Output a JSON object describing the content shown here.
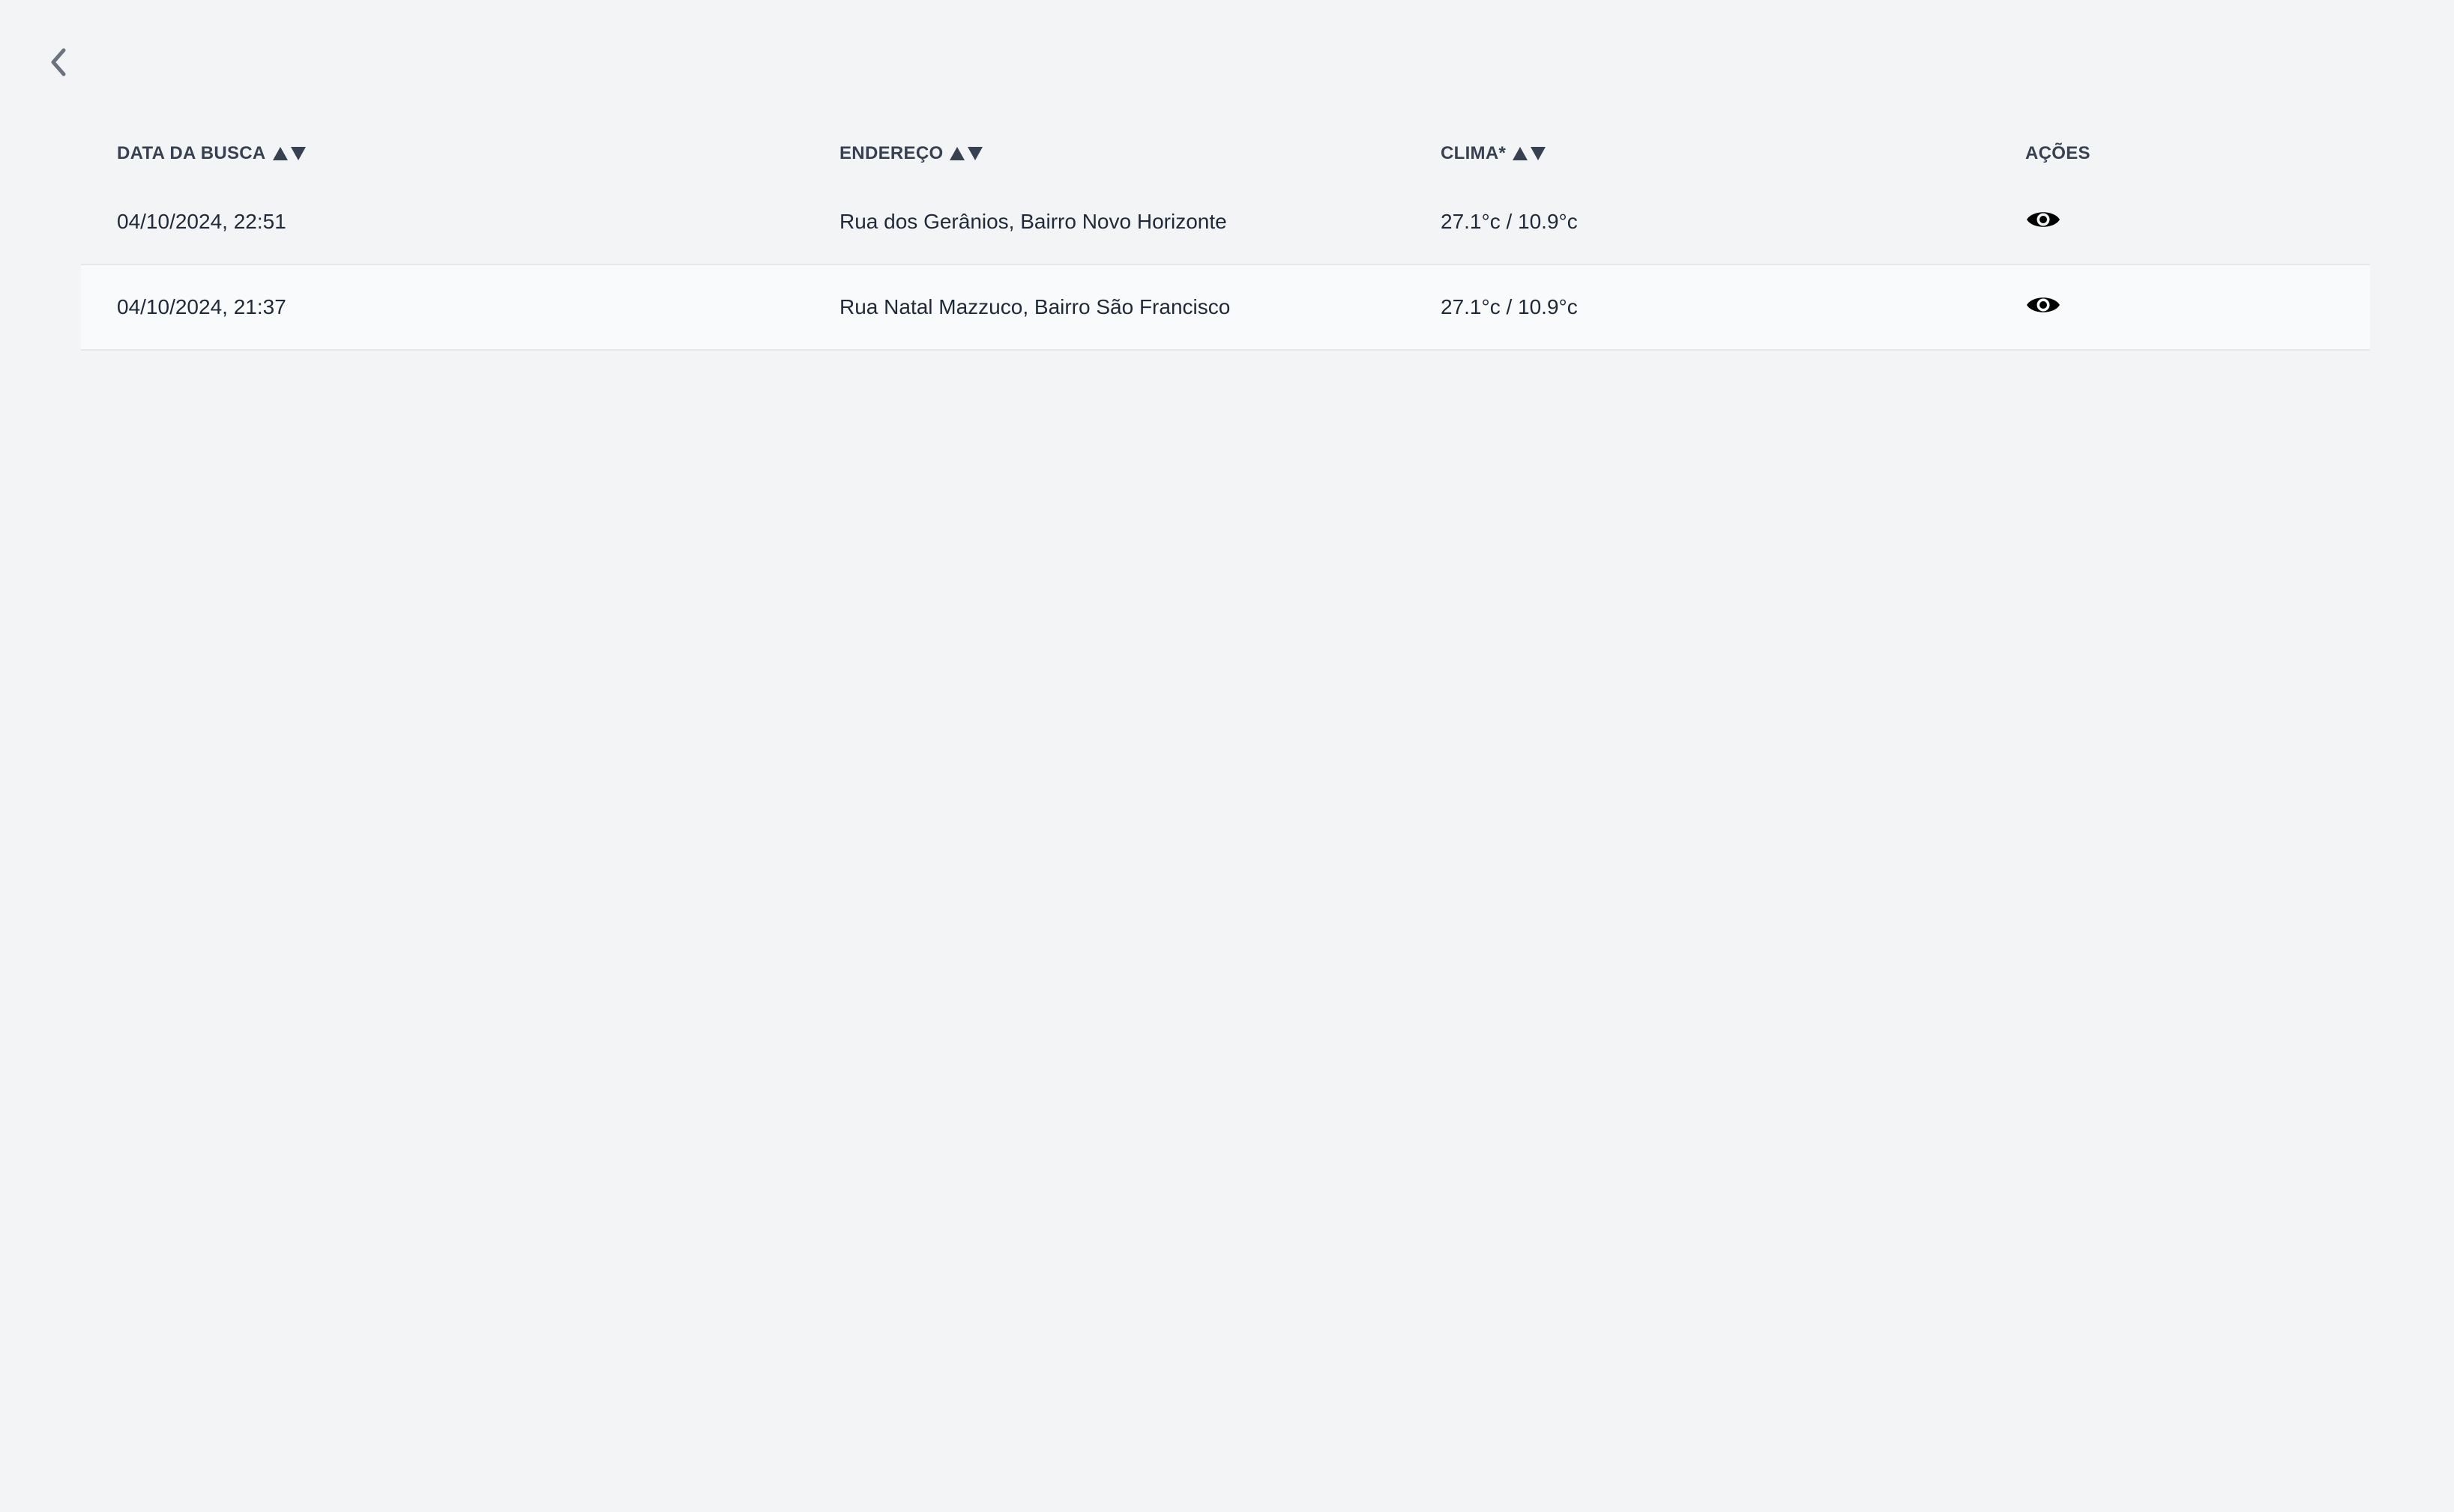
{
  "nav": {
    "back_icon": "chevron-left-icon"
  },
  "table": {
    "columns": [
      {
        "label": "DATA DA BUSCA",
        "sortable": true
      },
      {
        "label": "ENDEREÇO",
        "sortable": true
      },
      {
        "label": "CLIMA*",
        "sortable": true
      },
      {
        "label": "AÇÕES",
        "sortable": false
      }
    ],
    "rows": [
      {
        "date": "04/10/2024, 22:51",
        "address": "Rua dos Gerânios, Bairro Novo Horizonte",
        "climate": "27.1°c / 10.9°c",
        "action_icon": "eye-icon"
      },
      {
        "date": "04/10/2024, 21:37",
        "address": "Rua Natal Mazzuco, Bairro São Francisco",
        "climate": "27.1°c / 10.9°c",
        "action_icon": "eye-icon"
      }
    ]
  },
  "colors": {
    "background": "#f3f4f6",
    "row_alt": "#f9fafb",
    "header_text": "#374151",
    "body_text": "#1f2937",
    "back_icon": "#6b7280",
    "eye_icon": "#000000"
  }
}
